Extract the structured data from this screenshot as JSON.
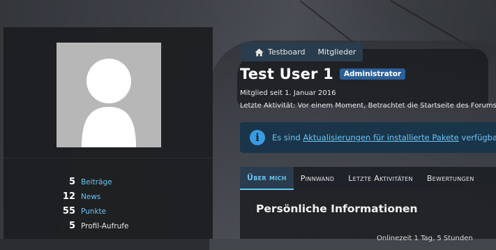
{
  "breadcrumb": {
    "items": [
      {
        "label": "Testboard",
        "icon": "home-icon"
      },
      {
        "label": "Mitglieder"
      }
    ]
  },
  "profile": {
    "username": "Test User 1",
    "rank_badge": "Administrator",
    "member_since": "Mitglied seit 1. Januar 2016",
    "last_activity": "Letzte Aktivität: Vor einem Moment, Betrachtet die Startseite des Forums"
  },
  "notice": {
    "icon": "info-icon",
    "text_before": "Es sind ",
    "link_text": "Aktualisierungen für installierte Pakete",
    "text_after": " verfügbar."
  },
  "tabs": [
    {
      "label": "Über mich",
      "active": true
    },
    {
      "label": "Pinnwand"
    },
    {
      "label": "Letzte Aktivitäten"
    },
    {
      "label": "Bewertungen"
    }
  ],
  "content": {
    "section_title": "Persönliche Informationen",
    "partial_row": "Onlinezeit      1 Tag, 5 Stunden"
  },
  "sidebar": {
    "stats": [
      {
        "value": "5",
        "label": "Beiträge",
        "link": true
      },
      {
        "value": "12",
        "label": "News",
        "link": true
      },
      {
        "value": "55",
        "label": "Punkte",
        "link": true
      },
      {
        "value": "5",
        "label": "Profil-Aufrufe",
        "link": false
      }
    ]
  },
  "colors": {
    "accent_link": "#6cc4f2",
    "badge_bg": "#2b5f98",
    "breadcrumb_bg": "#2a3d4e",
    "notice_bg": "#17344b"
  }
}
